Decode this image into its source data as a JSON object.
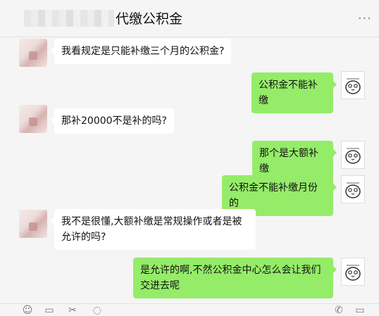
{
  "header": {
    "title": "代缴公积金",
    "more_icon": "ellipsis-icon"
  },
  "messages": [
    {
      "side": "left",
      "text": "我看规定是只能补缴三个月的公积金?"
    },
    {
      "side": "right",
      "text": "公积金不能补缴"
    },
    {
      "side": "left",
      "text": "那补20000不是补的吗?"
    },
    {
      "side": "right",
      "text": "那个是大额补缴"
    },
    {
      "side": "right",
      "text": "公积金不能补缴月份的"
    },
    {
      "side": "left",
      "text": "我不是很懂,大额补缴是常规操作或者是被允许的吗?"
    },
    {
      "side": "right",
      "text": "是允许的啊,不然公积金中心怎么会让我们交进去呢"
    }
  ],
  "colors": {
    "outgoing_bubble": "#95ec69",
    "incoming_bubble": "#ffffff",
    "background": "#f5f5f5"
  },
  "toolbar": {
    "icons": [
      "emoji-icon",
      "folder-icon",
      "scissors-icon",
      "chat-bubble-icon",
      "phone-icon",
      "video-call-icon"
    ]
  }
}
